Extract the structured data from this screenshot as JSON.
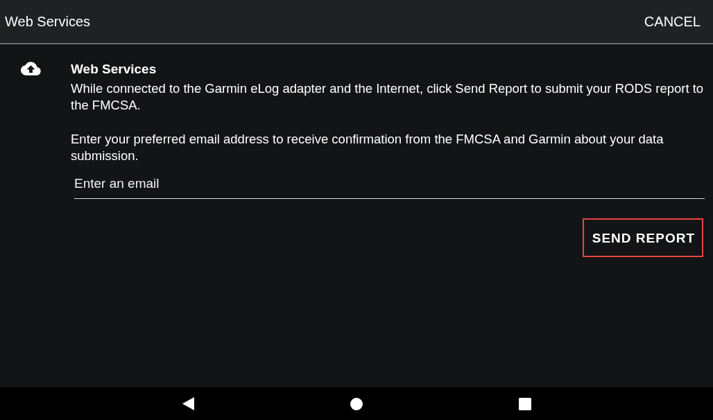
{
  "header": {
    "title": "Web Services",
    "cancel": "CANCEL"
  },
  "section": {
    "title": "Web Services",
    "paragraphs": [
      "While connected to the Garmin eLog adapter and the Internet, click Send Report to submit your RODS report to the FMCSA.",
      "Enter your preferred email address to receive confirmation from the FMCSA and Garmin about your data submission."
    ],
    "email": {
      "placeholder": "Enter an email"
    },
    "send": "SEND REPORT"
  }
}
